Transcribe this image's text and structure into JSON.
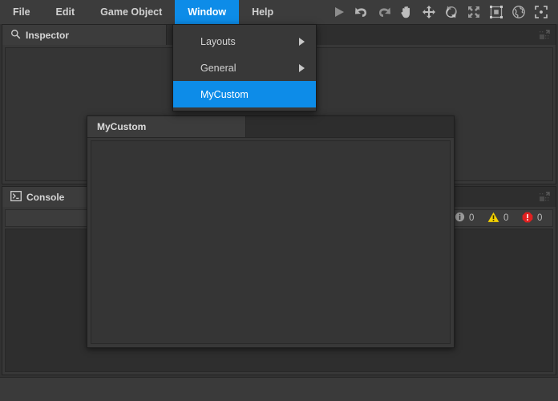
{
  "menubar": {
    "items": [
      {
        "label": "File",
        "active": false,
        "name": "menu-file"
      },
      {
        "label": "Edit",
        "active": false,
        "name": "menu-edit"
      },
      {
        "label": "Game Object",
        "active": false,
        "name": "menu-game-object"
      },
      {
        "label": "Window",
        "active": true,
        "name": "menu-window"
      },
      {
        "label": "Help",
        "active": false,
        "name": "menu-help"
      }
    ],
    "active_color": "#0d8ce8"
  },
  "toolbar": {
    "buttons": [
      {
        "icon": "play-icon",
        "label": "Play"
      },
      {
        "icon": "undo-icon",
        "label": "Undo"
      },
      {
        "icon": "redo-icon",
        "label": "Redo"
      },
      {
        "icon": "hand-tool-icon",
        "label": "Hand Tool"
      },
      {
        "icon": "move-tool-icon",
        "label": "Move Tool"
      },
      {
        "icon": "rotate-tool-icon",
        "label": "Rotate Tool"
      },
      {
        "icon": "scale-tool-icon",
        "label": "Scale Tool"
      },
      {
        "icon": "rect-transform-icon",
        "label": "Rect Transform Tool"
      },
      {
        "icon": "globe-icon",
        "label": "Global / Local"
      },
      {
        "icon": "pivot-center-icon",
        "label": "Pivot / Center"
      }
    ]
  },
  "dropdown": {
    "owner": "Window",
    "items": [
      {
        "label": "Layouts",
        "submenu": true,
        "highlighted": false,
        "name": "menu-item-layouts"
      },
      {
        "label": "General",
        "submenu": true,
        "highlighted": false,
        "name": "menu-item-general"
      },
      {
        "label": "MyCustom",
        "submenu": false,
        "highlighted": true,
        "name": "menu-item-mycustom"
      }
    ],
    "highlight_color": "#0d8ce8"
  },
  "inspector_dock": {
    "tab_label": "Inspector",
    "tab_icon": "search-icon",
    "maximize_icon": "maximize-icon"
  },
  "console_dock": {
    "tab_label": "Console",
    "tab_icon": "console-terminal-icon",
    "maximize_icon": "maximize-icon",
    "counters": [
      {
        "icon": "info-icon",
        "count": "0",
        "color": "#b9b9b9"
      },
      {
        "icon": "warning-icon",
        "count": "0",
        "color": "#f2d000"
      },
      {
        "icon": "error-icon",
        "count": "0",
        "color": "#e02020"
      }
    ]
  },
  "float_window": {
    "tab_label": "MyCustom",
    "content": ""
  },
  "statusbar": {
    "text": ""
  }
}
